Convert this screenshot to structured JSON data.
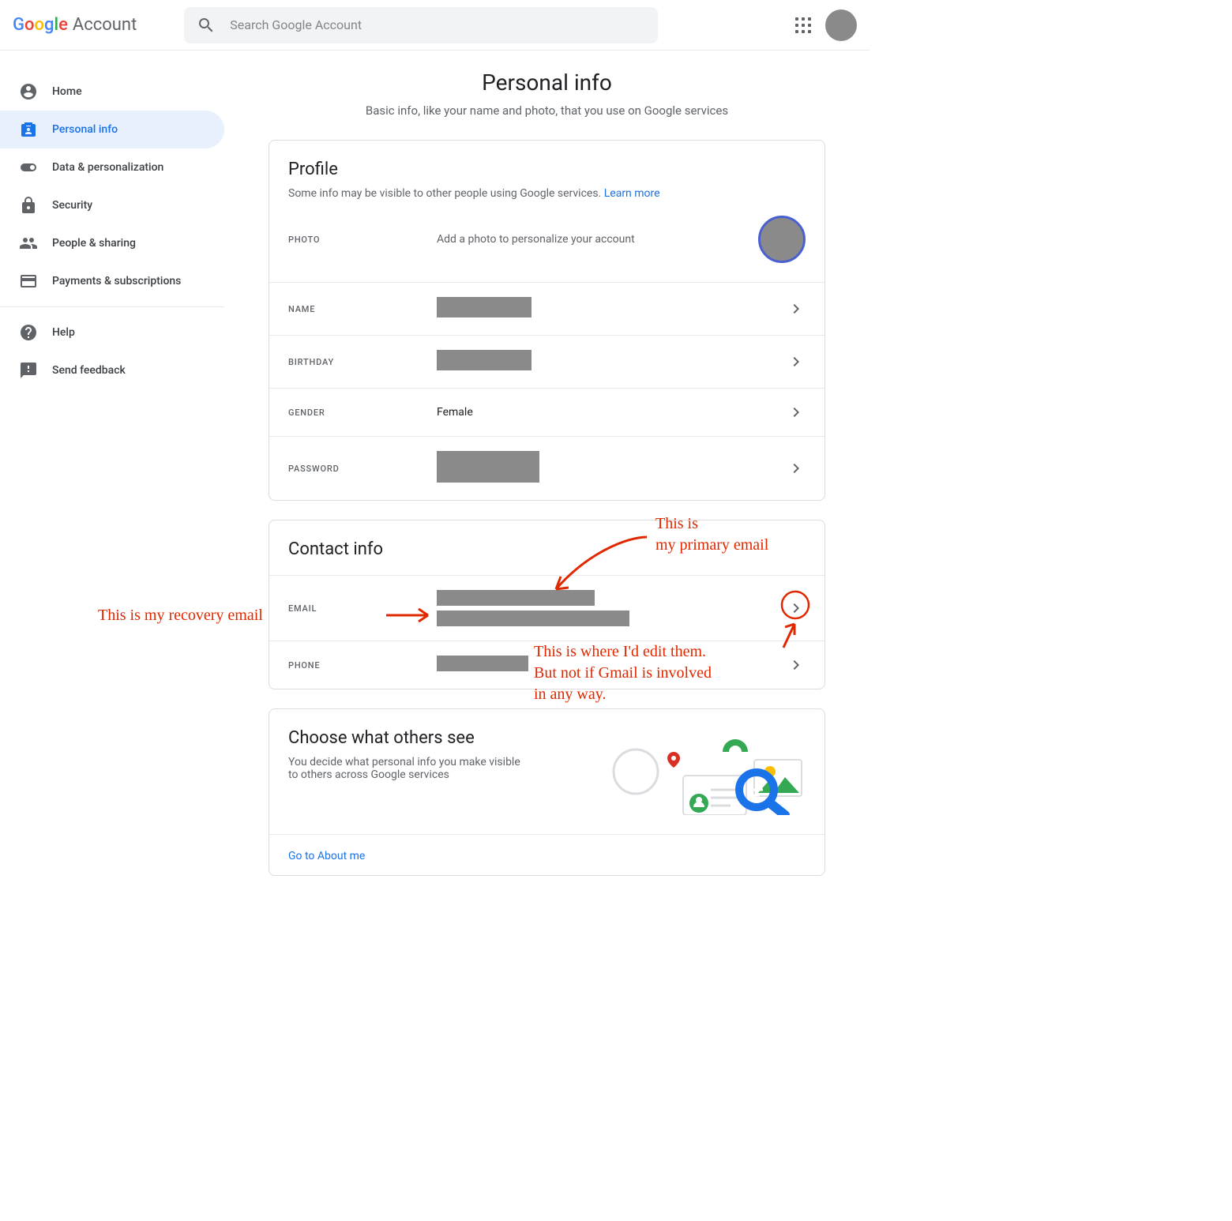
{
  "header": {
    "logo_word": "Google",
    "logo_suffix": "Account",
    "search_placeholder": "Search Google Account"
  },
  "sidebar": {
    "items": [
      {
        "label": "Home"
      },
      {
        "label": "Personal info"
      },
      {
        "label": "Data & personalization"
      },
      {
        "label": "Security"
      },
      {
        "label": "People & sharing"
      },
      {
        "label": "Payments & subscriptions"
      },
      {
        "label": "Help"
      },
      {
        "label": "Send feedback"
      }
    ]
  },
  "page": {
    "title": "Personal info",
    "subtitle": "Basic info, like your name and photo, that you use on Google services"
  },
  "profile": {
    "title": "Profile",
    "subtitle": "Some info may be visible to other people using Google services. ",
    "learn_more": "Learn more",
    "photo_label": "PHOTO",
    "photo_text": "Add a photo to personalize your account",
    "rows": {
      "name_label": "NAME",
      "birthday_label": "BIRTHDAY",
      "gender_label": "GENDER",
      "gender_value": "Female",
      "password_label": "PASSWORD"
    }
  },
  "contact": {
    "title": "Contact info",
    "email_label": "EMAIL",
    "phone_label": "PHONE"
  },
  "others": {
    "title": "Choose what others see",
    "subtitle": "You decide what personal info you make visible to others across Google services",
    "link": "Go to About me"
  },
  "annotations": {
    "primary": "This is\nmy primary email",
    "recovery": "This is my recovery email",
    "edit": "This is where I'd edit them.\nBut not if Gmail is involved\nin any way."
  }
}
